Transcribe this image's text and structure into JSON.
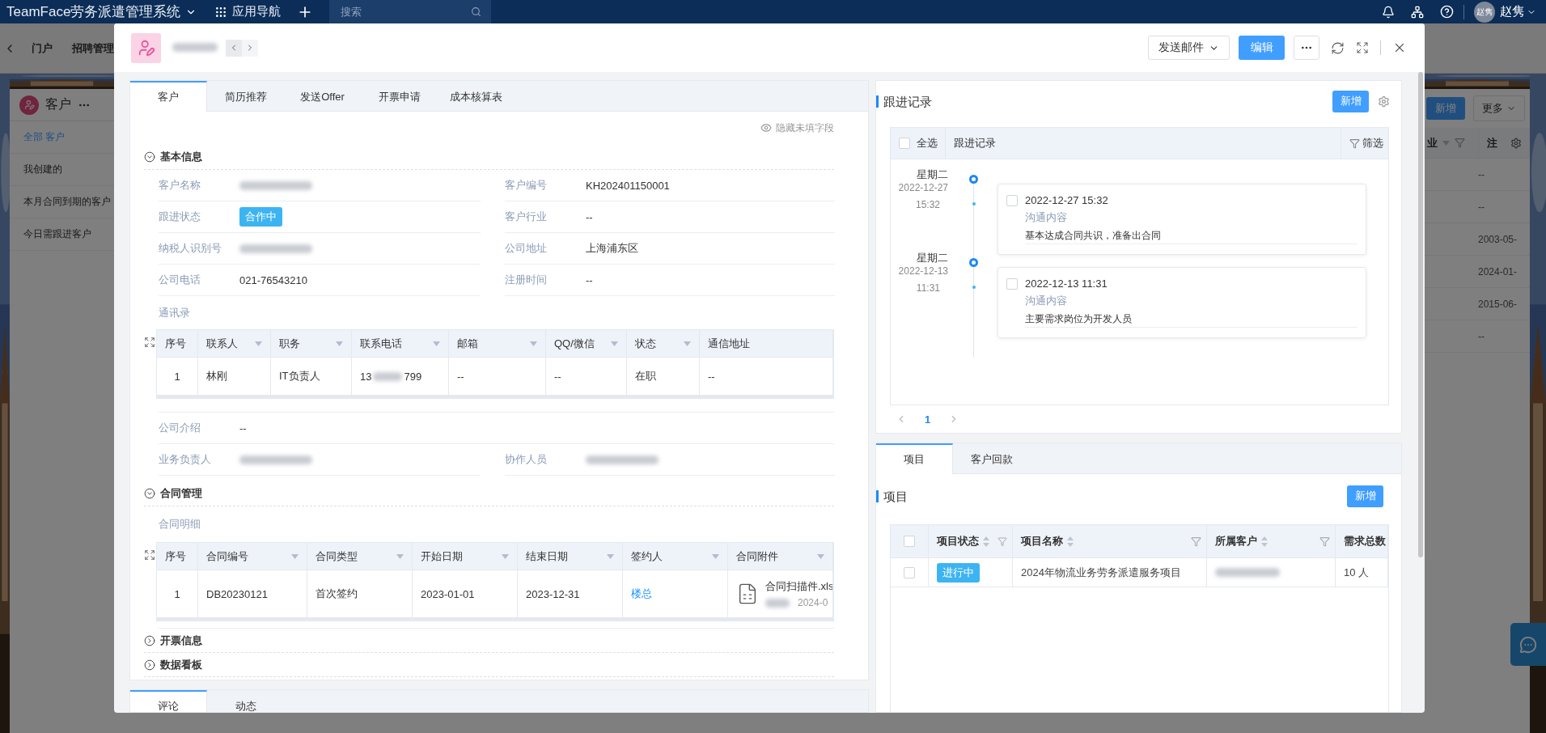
{
  "app_bar": {
    "title": "TeamFace劳务派遣管理系统",
    "nav": "应用导航",
    "search": {
      "placeholder": "搜索"
    },
    "user": {
      "avatar": "赵隽",
      "name": "赵隽"
    }
  },
  "sub_nav": {
    "items": [
      "门户",
      "招聘管理"
    ]
  },
  "customer_list": {
    "title": "客户",
    "views": [
      {
        "label": "全部 客户",
        "selected": true
      },
      {
        "label": "我创建的",
        "selected": false
      },
      {
        "label": "本月合同到期的客户",
        "selected": false
      },
      {
        "label": "今日需跟进客户",
        "selected": false
      }
    ],
    "add": "新增",
    "more": "更多",
    "columns": [
      "业",
      "注"
    ],
    "cells": [
      "--",
      "--",
      "2003-05-",
      "2024-01-",
      "2015-06-",
      "--"
    ]
  },
  "modal": {
    "header": {
      "send_mail": "发送邮件",
      "edit": "编辑"
    },
    "tabs": [
      {
        "label": "客户",
        "selected": true
      },
      {
        "label": "简历推荐",
        "selected": false
      },
      {
        "label": "发送Offer",
        "selected": false
      },
      {
        "label": "开票申请",
        "selected": false
      },
      {
        "label": "成本核算表",
        "selected": false
      }
    ],
    "hide_empty": "隐藏未填字段",
    "basic_info": {
      "title": "基本信息",
      "expanded": true,
      "fields": [
        {
          "label": "客户名称",
          "kind": "redacted"
        },
        {
          "label": "客户编号",
          "kind": "text",
          "value": "KH202401150001"
        },
        {
          "label": "跟进状态",
          "kind": "tag",
          "value": "合作中"
        },
        {
          "label": "客户行业",
          "kind": "text",
          "value": "--"
        },
        {
          "label": "纳税人识别号",
          "kind": "redacted"
        },
        {
          "label": "公司地址",
          "kind": "text",
          "value": "上海浦东区"
        },
        {
          "label": "公司电话",
          "kind": "text",
          "value": "021-76543210"
        },
        {
          "label": "注册时间",
          "kind": "text",
          "value": "--"
        }
      ],
      "contacts": {
        "title": "通讯录",
        "columns": [
          {
            "label": "序号",
            "kind": "plain"
          },
          {
            "label": "联系人",
            "kind": "dropdown"
          },
          {
            "label": "职务",
            "kind": "dropdown"
          },
          {
            "label": "联系电话",
            "kind": "dropdown"
          },
          {
            "label": "邮箱",
            "kind": "dropdown"
          },
          {
            "label": "QQ/微信",
            "kind": "dropdown"
          },
          {
            "label": "状态",
            "kind": "dropdown"
          },
          {
            "label": "通信地址",
            "kind": "plain"
          }
        ],
        "rows": [
          [
            "1",
            "林刚",
            "IT负责人",
            {
              "kind": "masked",
              "start": "13",
              "end": "799"
            },
            "--",
            "--",
            "在职",
            "--"
          ]
        ]
      },
      "intro": {
        "label": "公司介绍",
        "kind": "text",
        "value": "--"
      },
      "people": [
        {
          "label": "业务负责人",
          "kind": "redacted"
        },
        {
          "label": "协作人员",
          "kind": "redacted"
        }
      ]
    },
    "contract": {
      "title": "合同管理",
      "expanded": true,
      "subtitle": "合同明细",
      "columns": [
        {
          "label": "序号",
          "kind": "plain"
        },
        {
          "label": "合同编号",
          "kind": "dropdown"
        },
        {
          "label": "合同类型",
          "kind": "dropdown"
        },
        {
          "label": "开始日期",
          "kind": "dropdown"
        },
        {
          "label": "结束日期",
          "kind": "dropdown"
        },
        {
          "label": "签约人",
          "kind": "dropdown"
        },
        {
          "label": "合同附件",
          "kind": "dropdown"
        }
      ],
      "rows": [
        [
          "1",
          "DB20230121",
          "首次签约",
          "2023-01-01",
          "2023-12-31",
          {
            "kind": "link",
            "text": "楼总"
          },
          {
            "kind": "file",
            "name": "合同扫描件.xls",
            "date": "2024-0"
          }
        ]
      ]
    },
    "collapsed_sections": [
      {
        "title": "开票信息",
        "expanded": false
      },
      {
        "title": "数据看板",
        "expanded": false
      }
    ],
    "bottom_tabs": [
      {
        "label": "评论",
        "selected": true
      },
      {
        "label": "动态",
        "selected": false
      }
    ],
    "follow_up": {
      "title": "跟进记录",
      "add": "新增",
      "select_all": {
        "label": "全选",
        "checked": false
      },
      "column": "跟进记录",
      "filter": "筛选",
      "entries": [
        {
          "weekday": "星期二",
          "date": "2022-12-27",
          "time": "15:32",
          "checked": false,
          "datetime": "2022-12-27 15:32",
          "label": "沟通内容",
          "text": "基本达成合同共识，准备出合同"
        },
        {
          "weekday": "星期二",
          "date": "2022-12-13",
          "time": "11:31",
          "checked": false,
          "datetime": "2022-12-13 11:31",
          "label": "沟通内容",
          "text": "主要需求岗位为开发人员"
        }
      ],
      "page": "1"
    },
    "project_tabs": [
      {
        "label": "项目",
        "selected": true
      },
      {
        "label": "客户回款",
        "selected": false
      }
    ],
    "projects": {
      "title": "项目",
      "add": "新增",
      "all_checked": false,
      "columns": [
        {
          "label": "项目状态",
          "kind": "sortable"
        },
        {
          "label": "项目名称",
          "kind": "sortable"
        },
        {
          "label": "所属客户",
          "kind": "sortable"
        },
        {
          "label": "需求总数",
          "kind": "plain"
        }
      ],
      "rows": [
        {
          "checked": false,
          "cells": [
            {
              "kind": "tag",
              "text": "进行中"
            },
            "2024年物流业务劳务派遣服务项目",
            {
              "kind": "redacted"
            },
            "10 人"
          ]
        }
      ]
    }
  }
}
